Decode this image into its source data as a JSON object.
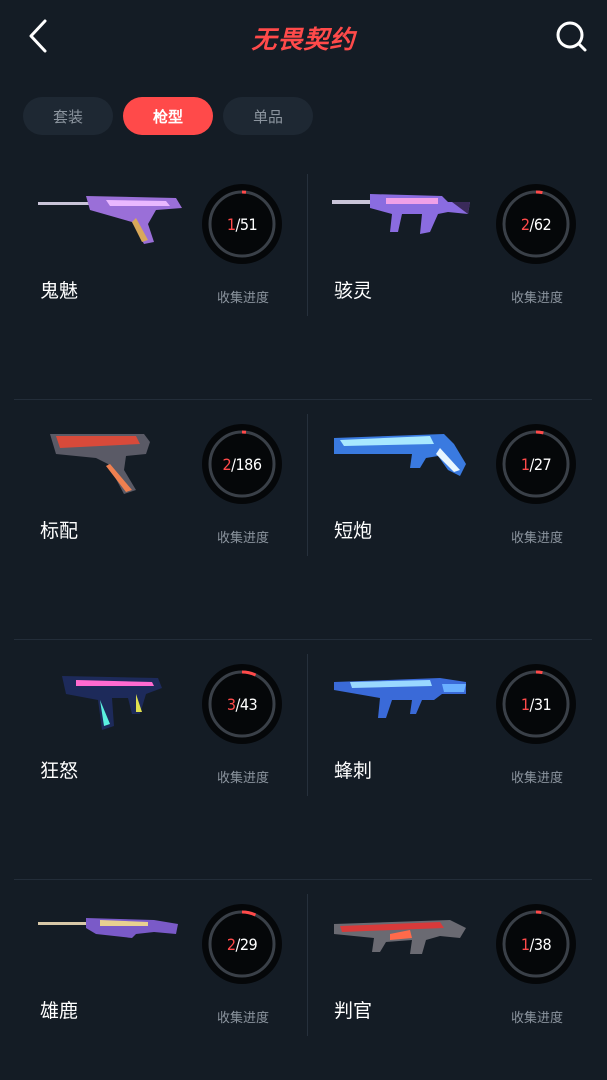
{
  "header": {
    "title": "无畏契约",
    "back_icon": "chevron-left-icon",
    "search_icon": "search-icon"
  },
  "tabs": [
    {
      "label": "套装",
      "active": false
    },
    {
      "label": "枪型",
      "active": true
    },
    {
      "label": "单品",
      "active": false
    }
  ],
  "weapons": [
    {
      "name": "鬼魅",
      "owned": "1",
      "total": "51",
      "progress_label": "收集进度",
      "icon": "pistol-ghost-icon"
    },
    {
      "name": "骇灵",
      "owned": "2",
      "total": "62",
      "progress_label": "收集进度",
      "icon": "smg-spectre-icon"
    },
    {
      "name": "标配",
      "owned": "2",
      "total": "186",
      "progress_label": "收集进度",
      "icon": "pistol-classic-icon"
    },
    {
      "name": "短炮",
      "owned": "1",
      "total": "27",
      "progress_label": "收集进度",
      "icon": "shotgun-shorty-icon"
    },
    {
      "name": "狂怒",
      "owned": "3",
      "total": "43",
      "progress_label": "收集进度",
      "icon": "pistol-frenzy-icon"
    },
    {
      "name": "蜂刺",
      "owned": "1",
      "total": "31",
      "progress_label": "收集进度",
      "icon": "smg-stinger-icon"
    },
    {
      "name": "雄鹿",
      "owned": "2",
      "total": "29",
      "progress_label": "收集进度",
      "icon": "shotgun-bucky-icon"
    },
    {
      "name": "判官",
      "owned": "1",
      "total": "38",
      "progress_label": "收集进度",
      "icon": "shotgun-judge-icon"
    }
  ],
  "colors": {
    "accent": "#ff4a4a",
    "background": "#141c25",
    "tab_inactive": "#1e2833",
    "muted_text": "#8b949e"
  }
}
